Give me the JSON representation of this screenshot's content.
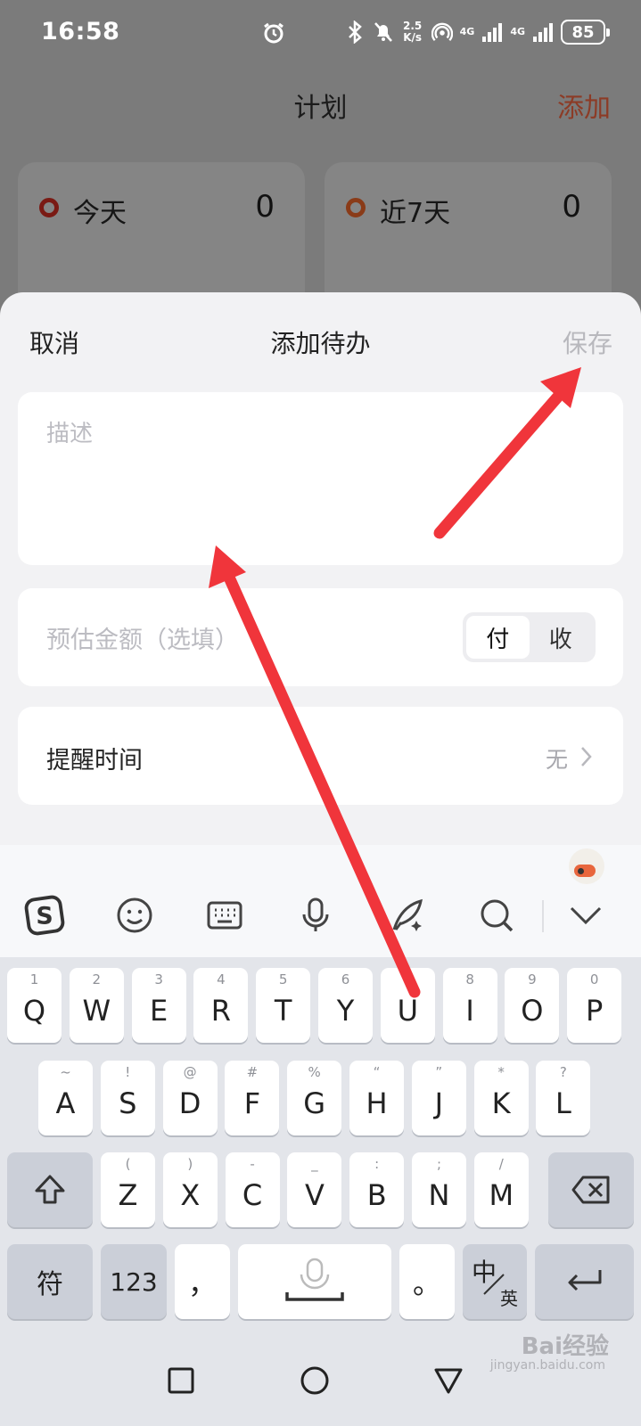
{
  "status_bar": {
    "time": "16:58",
    "speed_top": "2.5",
    "speed_bottom": "K/s",
    "net1": "4G",
    "net2": "4G",
    "battery": "85"
  },
  "background_app": {
    "title": "计划",
    "add_label": "添加",
    "cards": [
      {
        "label": "今天",
        "count": "0"
      },
      {
        "label": "近7天",
        "count": "0"
      }
    ]
  },
  "sheet": {
    "cancel_label": "取消",
    "title": "添加待办",
    "save_label": "保存",
    "description_placeholder": "描述",
    "amount_placeholder": "预估金额（选填）",
    "segment": {
      "pay": "付",
      "receive": "收",
      "selected": "付"
    },
    "reminder": {
      "label": "提醒时间",
      "value": "无"
    }
  },
  "keyboard": {
    "toolbar_icons": [
      "sogou-logo-icon",
      "emoji-icon",
      "keyboard-icon",
      "microphone-icon",
      "handwriting-icon",
      "search-icon",
      "collapse-icon"
    ],
    "rows": [
      [
        [
          "Q",
          "1"
        ],
        [
          "W",
          "2"
        ],
        [
          "E",
          "3"
        ],
        [
          "R",
          "4"
        ],
        [
          "T",
          "5"
        ],
        [
          "Y",
          "6"
        ],
        [
          "U",
          "7"
        ],
        [
          "I",
          "8"
        ],
        [
          "O",
          "9"
        ],
        [
          "P",
          "0"
        ]
      ],
      [
        [
          "A",
          "~"
        ],
        [
          "S",
          "!"
        ],
        [
          "D",
          "@"
        ],
        [
          "F",
          "#"
        ],
        [
          "G",
          "%"
        ],
        [
          "H",
          "“"
        ],
        [
          "J",
          "”"
        ],
        [
          "K",
          "*"
        ],
        [
          "L",
          "?"
        ]
      ],
      [
        [
          "Z",
          "("
        ],
        [
          "X",
          ")"
        ],
        [
          "C",
          "-"
        ],
        [
          "V",
          "_"
        ],
        [
          "B",
          ":"
        ],
        [
          "N",
          ";"
        ],
        [
          "M",
          "/"
        ]
      ]
    ],
    "symbols_key": "符",
    "numbers_key": "123",
    "comma_key": "，",
    "period_key": "。",
    "lang_key_main": "中",
    "lang_key_sub": "英"
  },
  "watermark": {
    "text": "Bai经验",
    "sub": "jingyan.baidu.com"
  },
  "colors": {
    "accent_red": "#f0353b",
    "add_button": "#8c3b26",
    "sheet_bg": "#f2f2f4"
  }
}
